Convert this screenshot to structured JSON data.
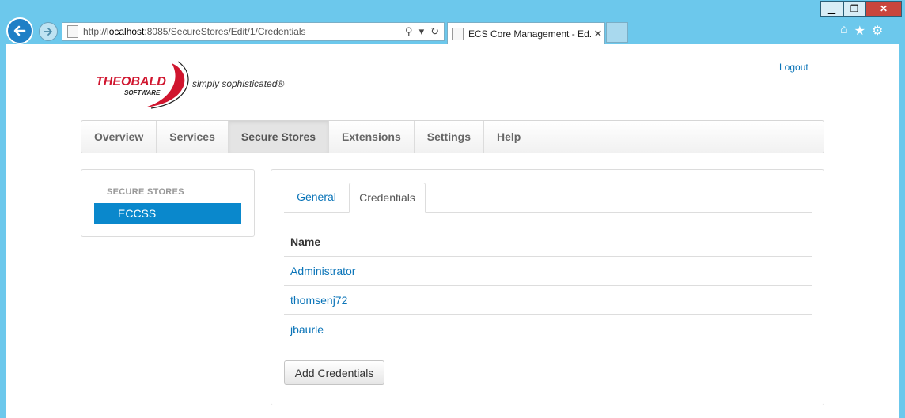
{
  "browser": {
    "url_prefix": "http://",
    "url_host": "localhost",
    "url_rest": ":8085/SecureStores/Edit/1/Credentials",
    "tab_title": "ECS Core Management - Ed...",
    "tab_close": "✕",
    "window_minimize": "▁",
    "window_maximize": "❐",
    "window_close": "✕"
  },
  "header": {
    "brand": "THEOBALD",
    "brand_sub": "SOFTWARE",
    "tagline": "simply sophisticated®",
    "logout": "Logout"
  },
  "nav": {
    "items": [
      "Overview",
      "Services",
      "Secure Stores",
      "Extensions",
      "Settings",
      "Help"
    ],
    "active": "Secure Stores"
  },
  "sidebar": {
    "heading": "SECURE STORES",
    "items": [
      {
        "label": "ECCSS",
        "selected": true
      }
    ]
  },
  "content": {
    "tabs": [
      "General",
      "Credentials"
    ],
    "active_tab": "Credentials",
    "table": {
      "header": "Name",
      "rows": [
        "Administrator",
        "thomsenj72",
        "jbaurle"
      ]
    },
    "add_button": "Add Credentials"
  },
  "colors": {
    "accent": "#0a88cc",
    "link": "#0a74b8",
    "chrome": "#6cc8ec",
    "brand_red": "#d0152e"
  }
}
